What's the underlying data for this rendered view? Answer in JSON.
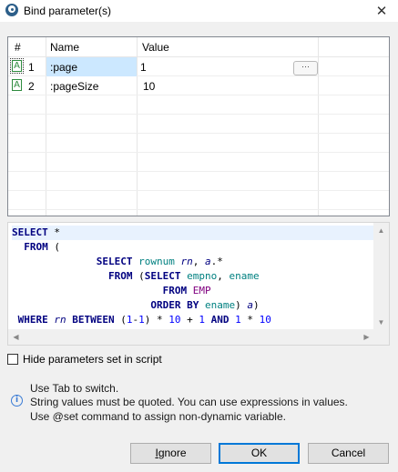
{
  "window": {
    "title": "Bind parameter(s)",
    "close_glyph": "✕"
  },
  "grid": {
    "columns": [
      "#",
      "Name",
      "Value"
    ],
    "rows": [
      {
        "index": "1",
        "name": ":page",
        "value": "1",
        "type_glyph": "A",
        "selected": true
      },
      {
        "index": "2",
        "name": ":pageSize",
        "value": "10",
        "type_glyph": "A",
        "selected": false
      }
    ],
    "edit_button_label": "···"
  },
  "sql": {
    "lines": [
      "SELECT *",
      "  FROM (",
      "              SELECT rownum rn, a.*",
      "                FROM (SELECT empno, ename",
      "                         FROM EMP",
      "                       ORDER BY ename) a)",
      " WHERE rn BETWEEN (1-1) * 10 + 1 AND 1 * 10"
    ]
  },
  "options": {
    "hide_params_label": "Hide parameters set in script",
    "hide_params_checked": false
  },
  "info": {
    "lines": [
      "Use Tab to switch.",
      "String values must be quoted. You can use expressions in values.",
      "Use @set command to assign non-dynamic variable."
    ]
  },
  "buttons": {
    "ignore_label": "Ignore",
    "ok_label": "OK",
    "cancel_label": "Cancel"
  },
  "colors": {
    "selection": "#cce8ff",
    "default_button_border": "#0078d7",
    "param_icon": "#2e8b3e",
    "keyword": "#000080"
  }
}
